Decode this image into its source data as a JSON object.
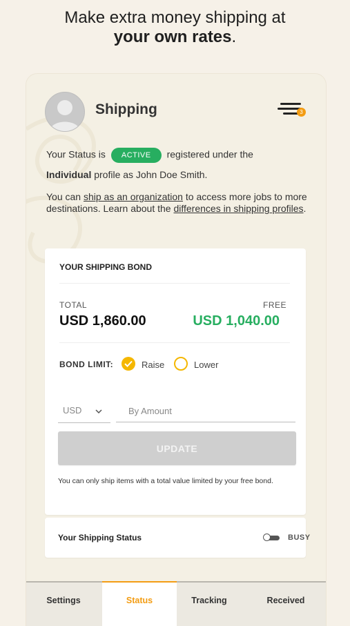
{
  "headline": {
    "line1": "Make extra money shipping at",
    "line2": "your own rates",
    "period": "."
  },
  "colors": {
    "accent": "#f39c12",
    "active_green": "#27ae60",
    "radio_yellow": "#f5b700",
    "background": "#f6f1e8"
  },
  "header": {
    "title": "Shipping",
    "menu_icon": "hamburger-menu-icon",
    "badge_count": "3"
  },
  "status": {
    "prefix": "Your Status is",
    "badge": "ACTIVE",
    "suffix": "registered under the",
    "profile_type": "Individual",
    "profile_rest": "profile as John Doe Smith."
  },
  "org": {
    "text1": "You can ",
    "link1": "ship as an organization",
    "text2": " to access more jobs to more destinations. Learn about the ",
    "link2": "differences in shipping profiles",
    "text3": "."
  },
  "bond": {
    "title": "YOUR SHIPPING BOND",
    "total_label": "TOTAL",
    "total_value": "USD 1,860.00",
    "free_label": "FREE",
    "free_value": "USD 1,040.00",
    "limit_label": "BOND LIMIT:",
    "options": [
      {
        "label": "Raise",
        "selected": true
      },
      {
        "label": "Lower",
        "selected": false
      }
    ],
    "currency": "USD",
    "amount_placeholder": "By Amount",
    "update_label": "UPDATE",
    "note": "You can only ship items with a total value limited by your free bond."
  },
  "shipping_status": {
    "label": "Your Shipping Status",
    "state": "BUSY"
  },
  "tabs": [
    {
      "label": "Settings",
      "active": false
    },
    {
      "label": "Status",
      "active": true
    },
    {
      "label": "Tracking",
      "active": false
    },
    {
      "label": "Received",
      "active": false
    }
  ]
}
